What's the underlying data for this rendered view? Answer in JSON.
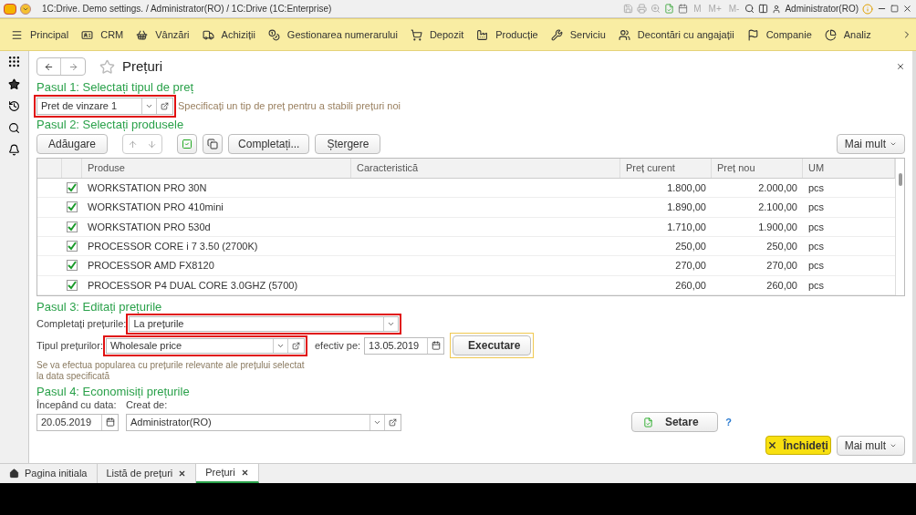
{
  "window": {
    "title": "1C:Drive. Demo settings. / Administrator(RO) / 1C:Drive  (1C:Enterprise)",
    "memory_buttons": [
      "M",
      "M+",
      "M-"
    ],
    "user": "Administrator(RO)"
  },
  "menu": [
    "Principal",
    "CRM",
    "Vânzări",
    "Achiziții",
    "Gestionarea numerarului",
    "Depozit",
    "Producție",
    "Serviciu",
    "Decontări cu angajații",
    "Companie",
    "Analiz"
  ],
  "form": {
    "title": "Prețuri",
    "step1": {
      "heading": "Pasul 1: Selectați tipul de preț",
      "price_type": "Pret de vinzare 1",
      "hint": "Specificați un tip de preț pentru a stabili prețuri noi"
    },
    "step2": {
      "heading": "Pasul 2: Selectați produsele",
      "buttons": [
        "Adăugare",
        "Completați...",
        "Ștergere"
      ],
      "more": "Mai mult",
      "table": {
        "columns": [
          "Produse",
          "Caracteristică",
          "Preț curent",
          "Preț nou",
          "UM"
        ],
        "rows": [
          {
            "checked": true,
            "product": "WORKSTATION PRO 30N",
            "current": "1.800,00",
            "new": "2.000,00",
            "um": "pcs"
          },
          {
            "checked": true,
            "product": "WORKSTATION PRO 410mini",
            "current": "1.890,00",
            "new": "2.100,00",
            "um": "pcs"
          },
          {
            "checked": true,
            "product": "WORKSTATION PRO 530d",
            "current": "1.710,00",
            "new": "1.900,00",
            "um": "pcs"
          },
          {
            "checked": true,
            "product": "PROCESSOR CORE i 7 3.50 (2700K)",
            "current": "250,00",
            "new": "250,00",
            "um": "pcs"
          },
          {
            "checked": true,
            "product": "PROCESSOR AMD FX8120",
            "current": "270,00",
            "new": "270,00",
            "um": "pcs"
          },
          {
            "checked": true,
            "product": "PROCESSOR P4 DUAL CORE 3.0GHZ (5700)",
            "current": "260,00",
            "new": "260,00",
            "um": "pcs"
          }
        ]
      }
    },
    "step3": {
      "heading": "Pasul 3: Editați prețurile",
      "fill_label": "Completați prețurile:",
      "fill_value": "La prețurile",
      "type_label": "Tipul prețurilor:",
      "type_value": "Wholesale price",
      "date_label": "efectiv pe:",
      "date_value": "13.05.2019",
      "execute": "Executare",
      "note": "Se va efectua popularea cu prețurile relevante ale prețului selectat la data specificată"
    },
    "step4": {
      "heading": "Pasul 4: Economisiți prețurile",
      "start_label": "Începând cu data:",
      "start_value": "20.05.2019",
      "author_label": "Creat de:",
      "author_value": "Administrator(RO)",
      "setup": "Setare",
      "help": "?"
    },
    "close": "Închideți",
    "more": "Mai mult"
  },
  "tabs": [
    {
      "label": "Pagina initiala",
      "kind": "home",
      "selected": false
    },
    {
      "label": "Listă de prețuri",
      "kind": "page",
      "selected": false
    },
    {
      "label": "Prețuri",
      "kind": "page",
      "selected": true
    }
  ]
}
